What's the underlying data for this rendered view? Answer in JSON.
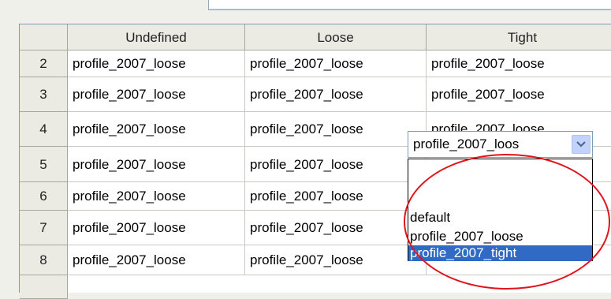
{
  "columns": [
    "Undefined",
    "Loose",
    "Tight"
  ],
  "rows": [
    {
      "num": "2",
      "cells": [
        "profile_2007_loose",
        "profile_2007_loose",
        "profile_2007_loose"
      ]
    },
    {
      "num": "3",
      "cells": [
        "profile_2007_loose",
        "profile_2007_loose",
        "profile_2007_loose"
      ]
    },
    {
      "num": "4",
      "cells": [
        "profile_2007_loose",
        "profile_2007_loose",
        "profile_2007_loose"
      ]
    },
    {
      "num": "5",
      "cells": [
        "profile_2007_loose",
        "profile_2007_loose",
        ""
      ]
    },
    {
      "num": "6",
      "cells": [
        "profile_2007_loose",
        "profile_2007_loose",
        ""
      ]
    },
    {
      "num": "7",
      "cells": [
        "profile_2007_loose",
        "profile_2007_loose",
        ""
      ]
    },
    {
      "num": "8",
      "cells": [
        "profile_2007_loose",
        "profile_2007_loose",
        ""
      ]
    }
  ],
  "editor": {
    "value": "profile_2007_loos",
    "options": [
      "",
      "default",
      "profile_2007_loose",
      "profile_2007_tight"
    ],
    "selected_option": "profile_2007_tight"
  },
  "colors": {
    "selection": "#316ac5",
    "annotation_circle": "#e0141c",
    "dropdown_button": "#c1d3fb"
  },
  "icons": {
    "dropdown_arrow": "chevron-down-icon"
  }
}
